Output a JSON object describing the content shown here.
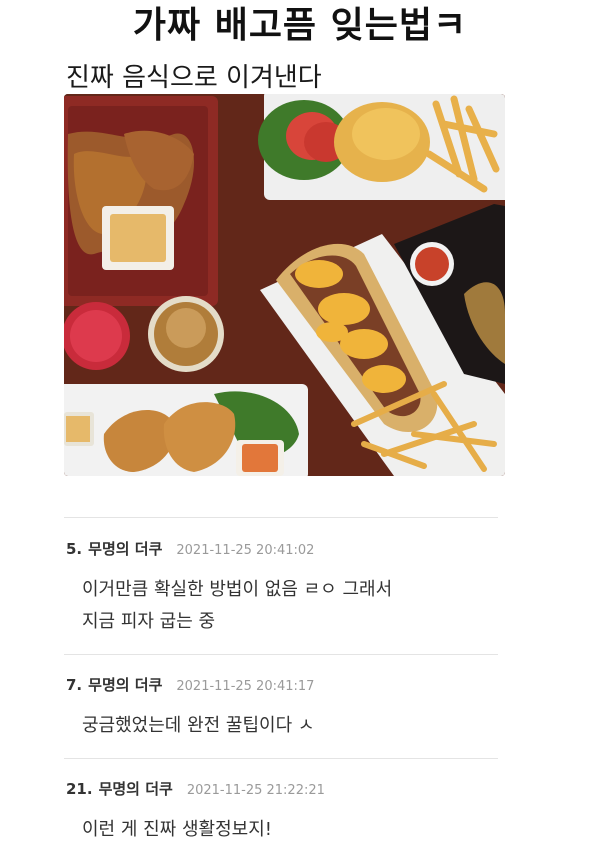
{
  "post": {
    "title": "가짜 배고픔 잊는법ㅋ",
    "subtitle": "진짜 음식으로 이겨낸다",
    "image_alt": "food-platter-photo"
  },
  "comments": [
    {
      "number": "5.",
      "author": "무명의 더쿠",
      "timestamp": "2021-11-25 20:41:02",
      "lines": [
        "이거만큼 확실한 방법이 없음 ㄹㅇ 그래서",
        "지금 피자 굽는 중"
      ]
    },
    {
      "number": "7.",
      "author": "무명의 더쿠",
      "timestamp": "2021-11-25 20:41:17",
      "lines": [
        "궁금했었는데 완전 꿀팁이다 ㅅ"
      ]
    },
    {
      "number": "21.",
      "author": "무명의 더쿠",
      "timestamp": "2021-11-25 21:22:21",
      "lines": [
        "이런 게 진짜 생활정보지!"
      ]
    }
  ]
}
